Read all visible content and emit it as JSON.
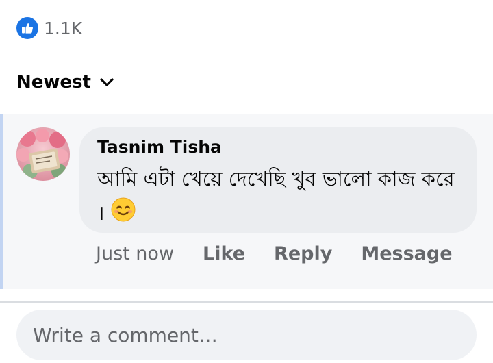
{
  "reactions": {
    "icon": "thumbs-up-icon",
    "count": "1.1K"
  },
  "sort": {
    "label": "Newest",
    "icon": "chevron-down-icon"
  },
  "comment": {
    "avatar": "avatar",
    "author": "Tasnim Tisha",
    "text": "আমি এটা খেয়ে দেখেছি খুব ভালো কাজ করে ।",
    "emoji": "smiling-face-icon",
    "timestamp": "Just now",
    "actions": {
      "like": "Like",
      "reply": "Reply",
      "message": "Message"
    }
  },
  "composer": {
    "placeholder": "Write a comment…"
  },
  "colors": {
    "accent": "#1b74e4",
    "secondary_text": "#65676b",
    "highlight_bar": "#c2d4f2",
    "bubble": "#ebedf0"
  }
}
